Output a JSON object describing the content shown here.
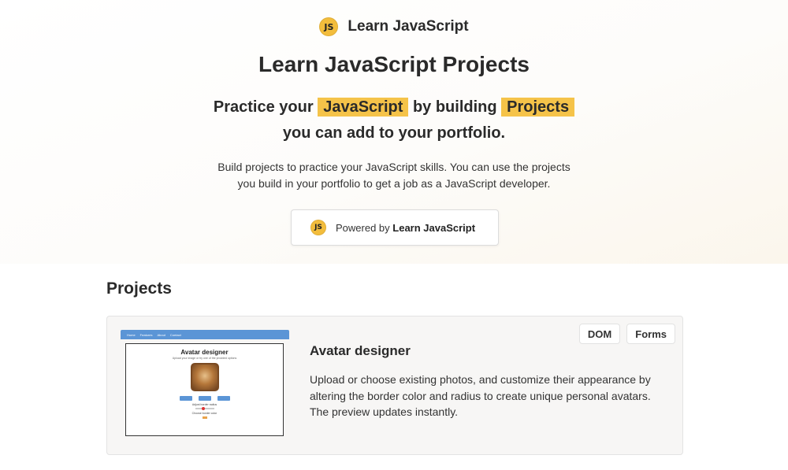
{
  "brand": {
    "logo_text": "JS",
    "name": "Learn JavaScript",
    "logo_color": "#f3bd3c"
  },
  "hero": {
    "title": "Learn JavaScript Projects",
    "tagline": {
      "part1": "Practice your",
      "highlight1": "JavaScript",
      "part2": "by building",
      "highlight2": "Projects",
      "line2": "you can add to your portfolio."
    },
    "description_line1": "Build projects to practice your JavaScript skills. You can use the projects",
    "description_line2": "you build in your portfolio to get a job as a JavaScript developer.",
    "powered_by": {
      "prefix": "Powered by",
      "name": "Learn JavaScript"
    },
    "highlight_color": "#f5c349"
  },
  "projects": {
    "heading": "Projects",
    "items": [
      {
        "name": "Avatar designer",
        "description": "Upload or choose existing photos, and customize their appearance by altering the border color and radius to create unique personal avatars. The preview updates instantly.",
        "tags": [
          "DOM",
          "Forms"
        ],
        "thumbnail": {
          "nav": [
            "Home",
            "Features",
            "About",
            "Contact"
          ],
          "title": "Avatar designer",
          "subtitle": "Upload your image or try one of the provided options",
          "buttons": [
            "Image 1",
            "Image 2",
            "Image 3"
          ],
          "radius_label": "Adjust border radius",
          "color_label": "Choose border color"
        }
      }
    ]
  }
}
